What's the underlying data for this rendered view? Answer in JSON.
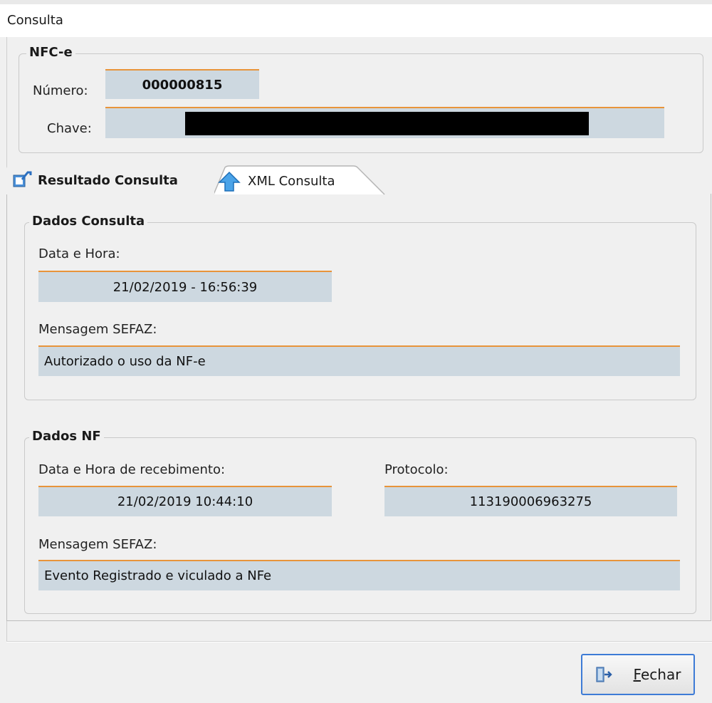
{
  "window": {
    "title": "Consulta"
  },
  "nfce": {
    "legend": "NFC-e",
    "numero_label": "Número:",
    "numero_value": "000000815",
    "chave_label": "Chave:"
  },
  "tabs": [
    {
      "label": "Resultado Consulta",
      "active": true,
      "icon": "result-icon"
    },
    {
      "label": "XML Consulta",
      "active": false,
      "icon": "arrow-up-icon"
    }
  ],
  "dados_consulta": {
    "legend": "Dados Consulta",
    "data_hora_label": "Data e Hora:",
    "data_hora_value": "21/02/2019 - 16:56:39",
    "mensagem_label": "Mensagem SEFAZ:",
    "mensagem_value": "Autorizado o uso da NF-e"
  },
  "dados_nf": {
    "legend": "Dados NF",
    "recebimento_label": "Data e Hora de recebimento:",
    "recebimento_value": "21/02/2019 10:44:10",
    "protocolo_label": "Protocolo:",
    "protocolo_value": "113190006963275",
    "mensagem_label": "Mensagem SEFAZ:",
    "mensagem_value": "Evento Registrado e viculado a NFe"
  },
  "footer": {
    "fechar_label_first": "F",
    "fechar_label_rest": "echar",
    "fechar_icon": "exit-door-icon"
  },
  "colors": {
    "field_bg": "#cdd8e0",
    "field_accent": "#e8943a",
    "button_border": "#3d7bd6"
  }
}
